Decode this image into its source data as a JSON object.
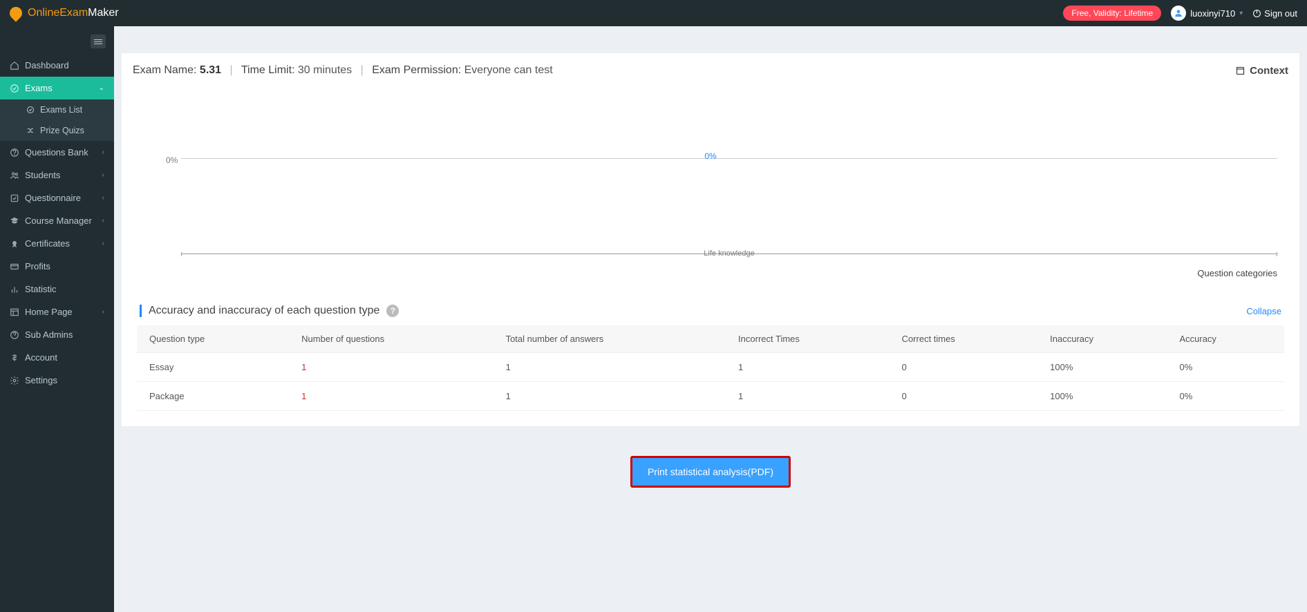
{
  "brand": {
    "name_a": "OnlineExam",
    "name_b": "Maker"
  },
  "topbar": {
    "badge": "Free, Validity: Lifetime",
    "username": "luoxinyi710",
    "signout": "Sign out"
  },
  "sidebar": {
    "items": [
      {
        "label": "Dashboard"
      },
      {
        "label": "Exams",
        "active": true,
        "expandable": true,
        "children": [
          {
            "label": "Exams List"
          },
          {
            "label": "Prize Quizs"
          }
        ]
      },
      {
        "label": "Questions Bank",
        "expandable": true
      },
      {
        "label": "Students",
        "expandable": true
      },
      {
        "label": "Questionnaire",
        "expandable": true
      },
      {
        "label": "Course Manager",
        "expandable": true
      },
      {
        "label": "Certificates",
        "expandable": true
      },
      {
        "label": "Profits"
      },
      {
        "label": "Statistic"
      },
      {
        "label": "Home Page",
        "expandable": true
      },
      {
        "label": "Sub Admins"
      },
      {
        "label": "Account"
      },
      {
        "label": "Settings"
      }
    ]
  },
  "header": {
    "exam_name_label": "Exam Name: ",
    "exam_name": "5.31",
    "time_limit_label": "Time Limit: ",
    "time_limit": "30 minutes",
    "permission_label": "Exam Permission: ",
    "permission": "Everyone can test",
    "context": "Context"
  },
  "chart_data": {
    "type": "bar",
    "categories": [
      "Life knowledge"
    ],
    "values": [
      0
    ],
    "data_labels": [
      "0%"
    ],
    "ylim": [
      0,
      0
    ],
    "y_tick_label": "0%",
    "x_title": "Question categories"
  },
  "section": {
    "title": "Accuracy and inaccuracy of each question type",
    "collapse": "Collapse"
  },
  "table": {
    "cols": [
      "Question type",
      "Number of questions",
      "Total number of answers",
      "Incorrect Times",
      "Correct times",
      "Inaccuracy",
      "Accuracy"
    ],
    "rows": [
      {
        "type": "Essay",
        "nq": "1",
        "answers": "1",
        "incorrect": "1",
        "correct": "0",
        "inacc": "100%",
        "acc": "0%"
      },
      {
        "type": "Package",
        "nq": "1",
        "answers": "1",
        "incorrect": "1",
        "correct": "0",
        "inacc": "100%",
        "acc": "0%"
      }
    ]
  },
  "print_btn": "Print statistical analysis(PDF)"
}
